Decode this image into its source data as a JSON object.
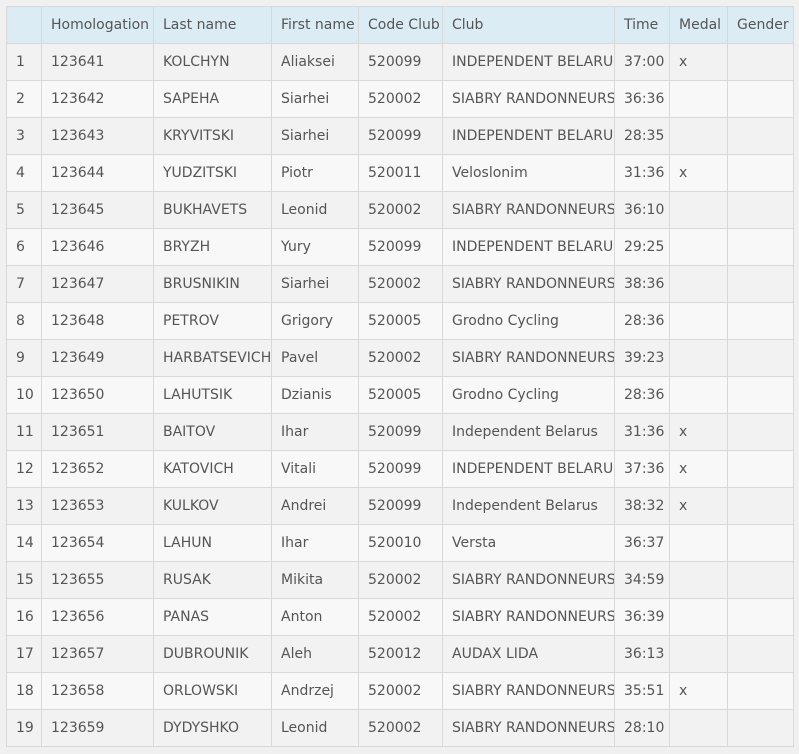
{
  "table": {
    "headers": [
      "",
      "Homologation",
      "Last name",
      "First name",
      "Code Club",
      "Club",
      "Time",
      "Medal",
      "Gender"
    ],
    "rows": [
      [
        "1",
        "123641",
        "KOLCHYN",
        "Aliaksei",
        "520099",
        "INDEPENDENT BELARUS",
        "37:00",
        "x",
        ""
      ],
      [
        "2",
        "123642",
        "SAPEHA",
        "Siarhei",
        "520002",
        "SIABRY RANDONNEURS",
        "36:36",
        "",
        ""
      ],
      [
        "3",
        "123643",
        "KRYVITSKI",
        "Siarhei",
        "520099",
        "INDEPENDENT BELARUS",
        "28:35",
        "",
        ""
      ],
      [
        "4",
        "123644",
        "YUDZITSKI",
        "Piotr",
        "520011",
        "Veloslonim",
        "31:36",
        "x",
        ""
      ],
      [
        "5",
        "123645",
        "BUKHAVETS",
        "Leonid",
        "520002",
        "SIABRY RANDONNEURS",
        "36:10",
        "",
        ""
      ],
      [
        "6",
        "123646",
        "BRYZH",
        "Yury",
        "520099",
        "INDEPENDENT BELARUS",
        "29:25",
        "",
        ""
      ],
      [
        "7",
        "123647",
        "BRUSNIKIN",
        "Siarhei",
        "520002",
        "SIABRY RANDONNEURS",
        "38:36",
        "",
        ""
      ],
      [
        "8",
        "123648",
        "PETROV",
        "Grigory",
        "520005",
        "Grodno Cycling",
        "28:36",
        "",
        ""
      ],
      [
        "9",
        "123649",
        "HARBATSEVICH",
        "Pavel",
        "520002",
        "SIABRY RANDONNEURS",
        "39:23",
        "",
        ""
      ],
      [
        "10",
        "123650",
        "LAHUTSIK",
        "Dzianis",
        "520005",
        "Grodno Cycling",
        "28:36",
        "",
        ""
      ],
      [
        "11",
        "123651",
        "BAITOV",
        "Ihar",
        "520099",
        "Independent Belarus",
        "31:36",
        "x",
        ""
      ],
      [
        "12",
        "123652",
        "KATOVICH",
        "Vitali",
        "520099",
        "INDEPENDENT BELARUS",
        "37:36",
        "x",
        ""
      ],
      [
        "13",
        "123653",
        "KULKOV",
        "Andrei",
        "520099",
        "Independent Belarus",
        "38:32",
        "x",
        ""
      ],
      [
        "14",
        "123654",
        "LAHUN",
        "Ihar",
        "520010",
        "Versta",
        "36:37",
        "",
        ""
      ],
      [
        "15",
        "123655",
        "RUSAK",
        "Mikita",
        "520002",
        "SIABRY RANDONNEURS",
        "34:59",
        "",
        ""
      ],
      [
        "16",
        "123656",
        "PANAS",
        "Anton",
        "520002",
        "SIABRY RANDONNEURS",
        "36:39",
        "",
        ""
      ],
      [
        "17",
        "123657",
        "DUBROUNIK",
        "Aleh",
        "520012",
        "AUDAX LIDA",
        "36:13",
        "",
        ""
      ],
      [
        "18",
        "123658",
        "ORLOWSKI",
        "Andrzej",
        "520002",
        "SIABRY RANDONNEURS",
        "35:51",
        "x",
        ""
      ],
      [
        "19",
        "123659",
        "DYDYSHKO",
        "Leonid",
        "520002",
        "SIABRY RANDONNEURS",
        "28:10",
        "",
        ""
      ]
    ]
  }
}
